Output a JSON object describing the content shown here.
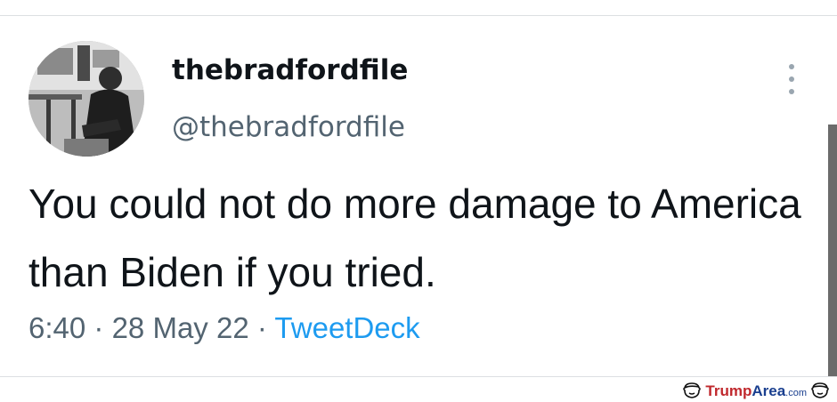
{
  "tweet": {
    "display_name": "thebradfordfile",
    "handle": "@thebradfordfile",
    "text": "You could not do more damage to America than Biden if you tried.",
    "time": "6:40",
    "separator": "·",
    "date": "28 May 22",
    "source": "TweetDeck"
  },
  "watermark": {
    "brand_part1": "Trump",
    "brand_part2": "Area",
    "suffix": ".com"
  },
  "icons": {
    "more": "more-vertical-icon",
    "watermark_left": "trump-face-icon",
    "watermark_right": "trump-face-icon"
  },
  "colors": {
    "text_primary": "#0f1419",
    "text_secondary": "#536471",
    "link": "#1d9bf0",
    "watermark_red": "#c0282d",
    "watermark_blue": "#1a3f8f"
  }
}
